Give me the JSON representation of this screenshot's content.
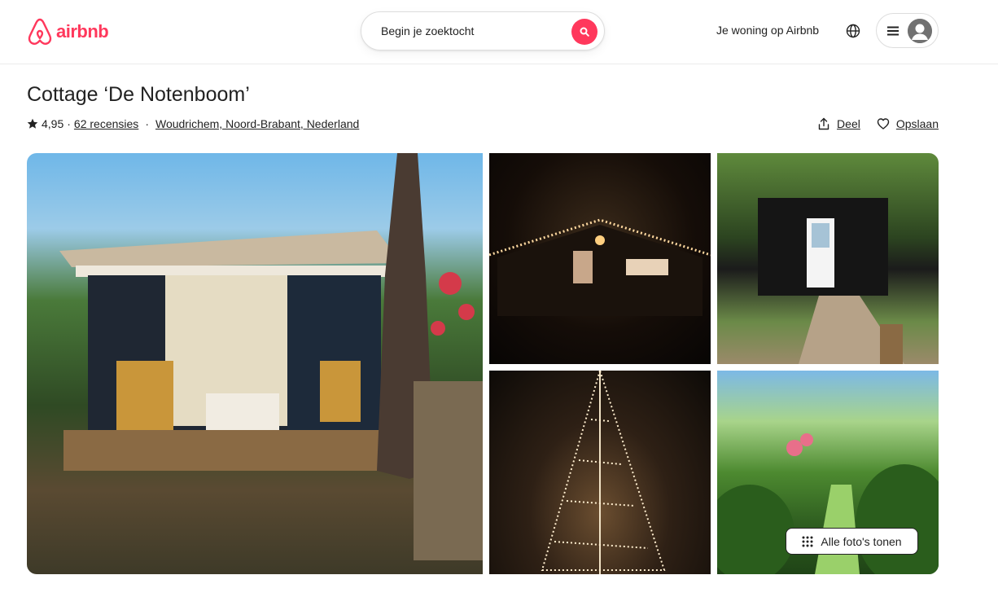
{
  "brand": {
    "name": "airbnb",
    "color": "#ff385c",
    "logo_icon": "airbnb-logo-icon"
  },
  "search": {
    "placeholder_text": "Begin je zoektocht",
    "icon": "search-icon"
  },
  "nav": {
    "host_link": "Je woning op Airbnb",
    "globe_icon": "globe-icon",
    "menu_icon": "hamburger-icon",
    "avatar_icon": "user-avatar-icon"
  },
  "listing": {
    "title": "Cottage ‘De Notenboom’",
    "rating": "4,95",
    "rating_separator": "·",
    "reviews": "62 recensies",
    "location": "Woudrichem, Noord-Brabant, Nederland"
  },
  "actions": {
    "share_label": "Deel",
    "save_label": "Opslaan",
    "share_icon": "share-icon",
    "save_icon": "heart-icon"
  },
  "gallery": {
    "show_all_label": "Alle foto's tonen",
    "show_all_icon": "grid-dots-icon",
    "photos": [
      {
        "name": "cottage-porch-photo"
      },
      {
        "name": "cottage-night-lights-photo"
      },
      {
        "name": "cottage-garden-door-photo"
      },
      {
        "name": "light-tree-photo"
      },
      {
        "name": "garden-path-photo"
      }
    ]
  }
}
